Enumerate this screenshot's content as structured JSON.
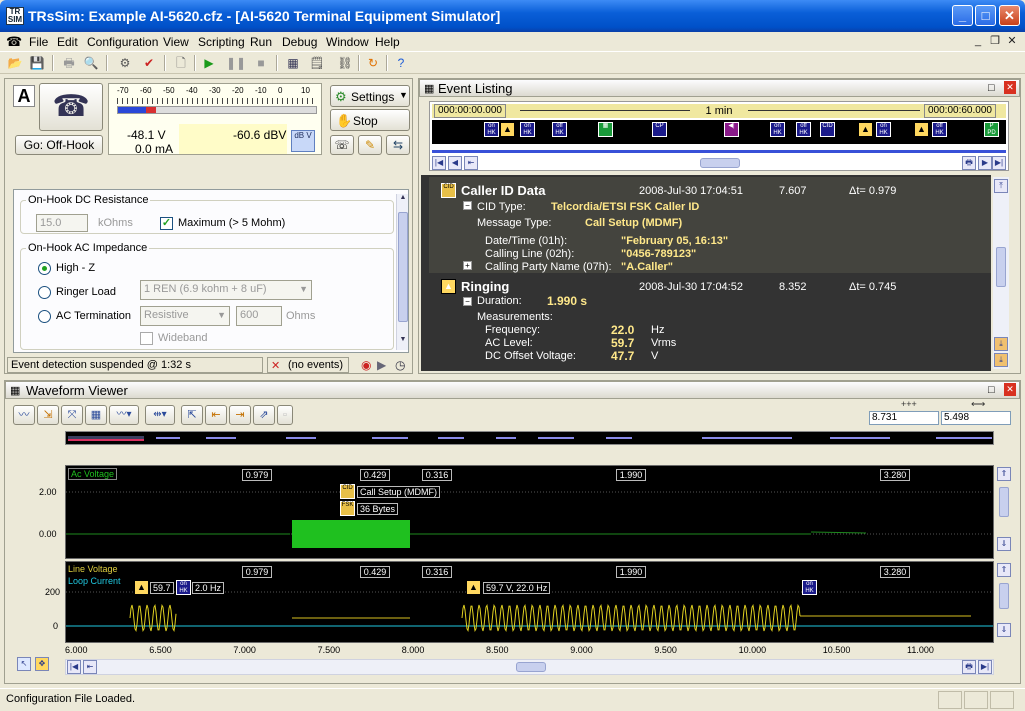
{
  "window": {
    "title": "TRsSim:  Example AI-5620.cfz - [AI-5620  Terminal Equipment Simulator]",
    "app_icon": "TR SIM",
    "controls": {
      "min": "_",
      "max": "□",
      "close": "✕"
    }
  },
  "menu": [
    "File",
    "Edit",
    "Configuration",
    "View",
    "Scripting",
    "Run",
    "Debug",
    "Window",
    "Help"
  ],
  "left": {
    "mode_letter": "A",
    "go_button": "Go:  Off-Hook",
    "scale": [
      "-70",
      "-60",
      "-50",
      "-40",
      "-30",
      "-20",
      "-10",
      "0",
      "10"
    ],
    "voltage": "-48.1  V",
    "current": "0.0 mA",
    "dbv": "-60.6 dBV",
    "dbv_btn": "dB V",
    "settings_btn": "Settings",
    "stop_btn": "Stop",
    "onhook_dc": "On-Hook DC Resistance",
    "dc_value": "15.0",
    "dc_unit": "kOhms",
    "maximum": "Maximum (> 5 Mohm)",
    "onhook_ac": "On-Hook AC Impedance",
    "highz": "High - Z",
    "ringer": "Ringer Load",
    "ringer_sel": "1 REN (6.9 kohm + 8 uF)",
    "acterm": "AC Termination",
    "acterm_sel": "Resistive",
    "acterm_val": "600",
    "acterm_unit": "Ohms",
    "wideband": "Wideband",
    "status": "Event detection suspended @ 1:32 s",
    "no_events": "(no events)"
  },
  "events": {
    "title": "Event Listing",
    "t_start": "000:00:00.000",
    "t_span": "1 min",
    "t_end": "000:00:60.000",
    "items": [
      {
        "name": "Caller ID Data",
        "date": "2008-Jul-30  17:04:51",
        "time": "7.607",
        "dt": "Δt= 0.979"
      },
      {
        "name": "Ringing",
        "date": "2008-Jul-30  17:04:52",
        "time": "8.352",
        "dt": "Δt= 0.745"
      }
    ],
    "cid": {
      "type_lbl": "CID Type:",
      "type_val": "Telcordia/ETSI FSK Caller ID",
      "msg_lbl": "Message Type:",
      "msg_val": "Call Setup (MDMF)",
      "rows": [
        [
          "Date/Time (01h):",
          "\"February 05, 16:13\""
        ],
        [
          "Calling Line (02h):",
          "\"0456-789123\""
        ],
        [
          "Calling Party Name (07h):",
          "\"A.Caller\""
        ]
      ]
    },
    "ring": {
      "dur_lbl": "Duration:",
      "dur_val": "1.990 s",
      "meas": "Measurements:",
      "rows": [
        [
          "Frequency:",
          "22.0",
          "Hz"
        ],
        [
          "AC Level:",
          "59.7",
          "Vrms"
        ],
        [
          "DC Offset Voltage:",
          "47.7",
          "V"
        ]
      ]
    }
  },
  "wave": {
    "title": "Waveform Viewer",
    "cursor1": "8.731",
    "cursor2": "5.498",
    "top_label": "Ac Voltage",
    "top_y": [
      "2.00",
      "0.00"
    ],
    "bot_label1": "Line Voltage",
    "bot_label2": "Loop Current",
    "bot_y": [
      "200",
      "0"
    ],
    "markers": [
      "0.979",
      "0.429",
      "0.316",
      "1.990",
      "3.280"
    ],
    "ann1": "Call Setup (MDMF)",
    "ann2": "36 Bytes",
    "ring1": "59.7",
    "ring1b": "2.0 Hz",
    "ring2": "59.7 V, 22.0 Hz",
    "x_ticks": [
      "6.000",
      "6.500",
      "7.000",
      "7.500",
      "8.000",
      "8.500",
      "9.000",
      "9.500",
      "10.000",
      "10.500",
      "11.000"
    ]
  },
  "statusbar": "Configuration File Loaded."
}
